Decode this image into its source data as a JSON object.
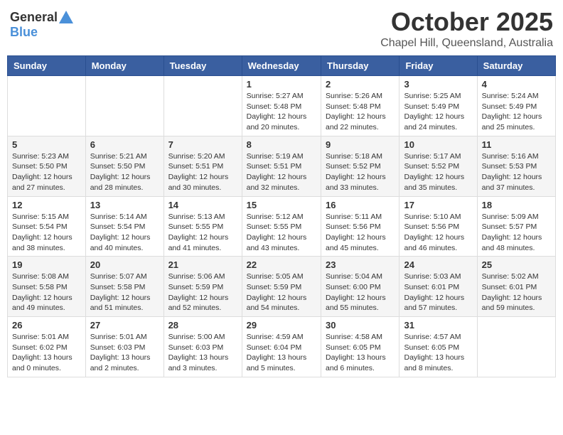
{
  "logo": {
    "general": "General",
    "blue": "Blue"
  },
  "title": "October 2025",
  "subtitle": "Chapel Hill, Queensland, Australia",
  "days_of_week": [
    "Sunday",
    "Monday",
    "Tuesday",
    "Wednesday",
    "Thursday",
    "Friday",
    "Saturday"
  ],
  "weeks": [
    [
      {
        "day": "",
        "info": ""
      },
      {
        "day": "",
        "info": ""
      },
      {
        "day": "",
        "info": ""
      },
      {
        "day": "1",
        "info": "Sunrise: 5:27 AM\nSunset: 5:48 PM\nDaylight: 12 hours\nand 20 minutes."
      },
      {
        "day": "2",
        "info": "Sunrise: 5:26 AM\nSunset: 5:48 PM\nDaylight: 12 hours\nand 22 minutes."
      },
      {
        "day": "3",
        "info": "Sunrise: 5:25 AM\nSunset: 5:49 PM\nDaylight: 12 hours\nand 24 minutes."
      },
      {
        "day": "4",
        "info": "Sunrise: 5:24 AM\nSunset: 5:49 PM\nDaylight: 12 hours\nand 25 minutes."
      }
    ],
    [
      {
        "day": "5",
        "info": "Sunrise: 5:23 AM\nSunset: 5:50 PM\nDaylight: 12 hours\nand 27 minutes."
      },
      {
        "day": "6",
        "info": "Sunrise: 5:21 AM\nSunset: 5:50 PM\nDaylight: 12 hours\nand 28 minutes."
      },
      {
        "day": "7",
        "info": "Sunrise: 5:20 AM\nSunset: 5:51 PM\nDaylight: 12 hours\nand 30 minutes."
      },
      {
        "day": "8",
        "info": "Sunrise: 5:19 AM\nSunset: 5:51 PM\nDaylight: 12 hours\nand 32 minutes."
      },
      {
        "day": "9",
        "info": "Sunrise: 5:18 AM\nSunset: 5:52 PM\nDaylight: 12 hours\nand 33 minutes."
      },
      {
        "day": "10",
        "info": "Sunrise: 5:17 AM\nSunset: 5:52 PM\nDaylight: 12 hours\nand 35 minutes."
      },
      {
        "day": "11",
        "info": "Sunrise: 5:16 AM\nSunset: 5:53 PM\nDaylight: 12 hours\nand 37 minutes."
      }
    ],
    [
      {
        "day": "12",
        "info": "Sunrise: 5:15 AM\nSunset: 5:54 PM\nDaylight: 12 hours\nand 38 minutes."
      },
      {
        "day": "13",
        "info": "Sunrise: 5:14 AM\nSunset: 5:54 PM\nDaylight: 12 hours\nand 40 minutes."
      },
      {
        "day": "14",
        "info": "Sunrise: 5:13 AM\nSunset: 5:55 PM\nDaylight: 12 hours\nand 41 minutes."
      },
      {
        "day": "15",
        "info": "Sunrise: 5:12 AM\nSunset: 5:55 PM\nDaylight: 12 hours\nand 43 minutes."
      },
      {
        "day": "16",
        "info": "Sunrise: 5:11 AM\nSunset: 5:56 PM\nDaylight: 12 hours\nand 45 minutes."
      },
      {
        "day": "17",
        "info": "Sunrise: 5:10 AM\nSunset: 5:56 PM\nDaylight: 12 hours\nand 46 minutes."
      },
      {
        "day": "18",
        "info": "Sunrise: 5:09 AM\nSunset: 5:57 PM\nDaylight: 12 hours\nand 48 minutes."
      }
    ],
    [
      {
        "day": "19",
        "info": "Sunrise: 5:08 AM\nSunset: 5:58 PM\nDaylight: 12 hours\nand 49 minutes."
      },
      {
        "day": "20",
        "info": "Sunrise: 5:07 AM\nSunset: 5:58 PM\nDaylight: 12 hours\nand 51 minutes."
      },
      {
        "day": "21",
        "info": "Sunrise: 5:06 AM\nSunset: 5:59 PM\nDaylight: 12 hours\nand 52 minutes."
      },
      {
        "day": "22",
        "info": "Sunrise: 5:05 AM\nSunset: 5:59 PM\nDaylight: 12 hours\nand 54 minutes."
      },
      {
        "day": "23",
        "info": "Sunrise: 5:04 AM\nSunset: 6:00 PM\nDaylight: 12 hours\nand 55 minutes."
      },
      {
        "day": "24",
        "info": "Sunrise: 5:03 AM\nSunset: 6:01 PM\nDaylight: 12 hours\nand 57 minutes."
      },
      {
        "day": "25",
        "info": "Sunrise: 5:02 AM\nSunset: 6:01 PM\nDaylight: 12 hours\nand 59 minutes."
      }
    ],
    [
      {
        "day": "26",
        "info": "Sunrise: 5:01 AM\nSunset: 6:02 PM\nDaylight: 13 hours\nand 0 minutes."
      },
      {
        "day": "27",
        "info": "Sunrise: 5:01 AM\nSunset: 6:03 PM\nDaylight: 13 hours\nand 2 minutes."
      },
      {
        "day": "28",
        "info": "Sunrise: 5:00 AM\nSunset: 6:03 PM\nDaylight: 13 hours\nand 3 minutes."
      },
      {
        "day": "29",
        "info": "Sunrise: 4:59 AM\nSunset: 6:04 PM\nDaylight: 13 hours\nand 5 minutes."
      },
      {
        "day": "30",
        "info": "Sunrise: 4:58 AM\nSunset: 6:05 PM\nDaylight: 13 hours\nand 6 minutes."
      },
      {
        "day": "31",
        "info": "Sunrise: 4:57 AM\nSunset: 6:05 PM\nDaylight: 13 hours\nand 8 minutes."
      },
      {
        "day": "",
        "info": ""
      }
    ]
  ]
}
